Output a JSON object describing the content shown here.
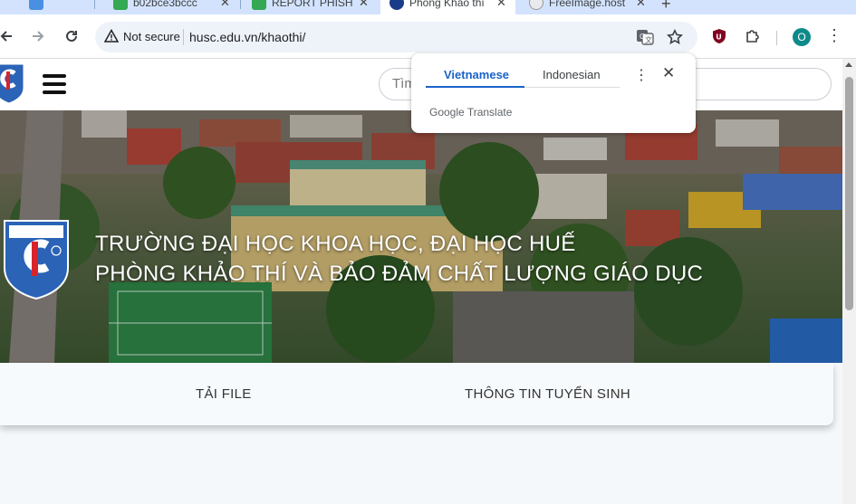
{
  "browser": {
    "tabs": [
      {
        "title": "",
        "favicon_color": "#4a90e2"
      },
      {
        "title": "b02bce3bccc",
        "favicon_color": "#34a853"
      },
      {
        "title": "REPORT PHISH",
        "favicon_color": "#34a853"
      },
      {
        "title": "Phòng Khảo thí",
        "favicon_color": "#1a3a8a",
        "active": true
      },
      {
        "title": "FreeImage.host",
        "favicon_color": "#e8eaed"
      }
    ],
    "new_tab": "+",
    "security_label": "Not secure",
    "url": "husc.edu.vn/khaothi/",
    "profile_initial": "O"
  },
  "site": {
    "search_placeholder": "Tìm kiếm",
    "hero": {
      "line1": "TRƯỜNG ĐẠI HỌC KHOA HỌC, ĐẠI HỌC HUẾ",
      "line2": "PHÒNG KHẢO THÍ VÀ BẢO ĐẢM CHẤT LƯỢNG GIÁO DỤC"
    },
    "nav": {
      "item1": "TẢI FILE",
      "item2": "THÔNG TIN TUYỂN SINH"
    }
  },
  "translate_popup": {
    "tab1": "Vietnamese",
    "tab2": "Indonesian",
    "brand": "Google Translate"
  },
  "colors": {
    "chrome_tabstrip": "#d3e3fd",
    "omnibox": "#eef2f9",
    "accent_blue": "#1a62c9",
    "hero_text": "#ffffff",
    "logo_blue": "#2b63b6",
    "logo_red": "#d8232a"
  }
}
